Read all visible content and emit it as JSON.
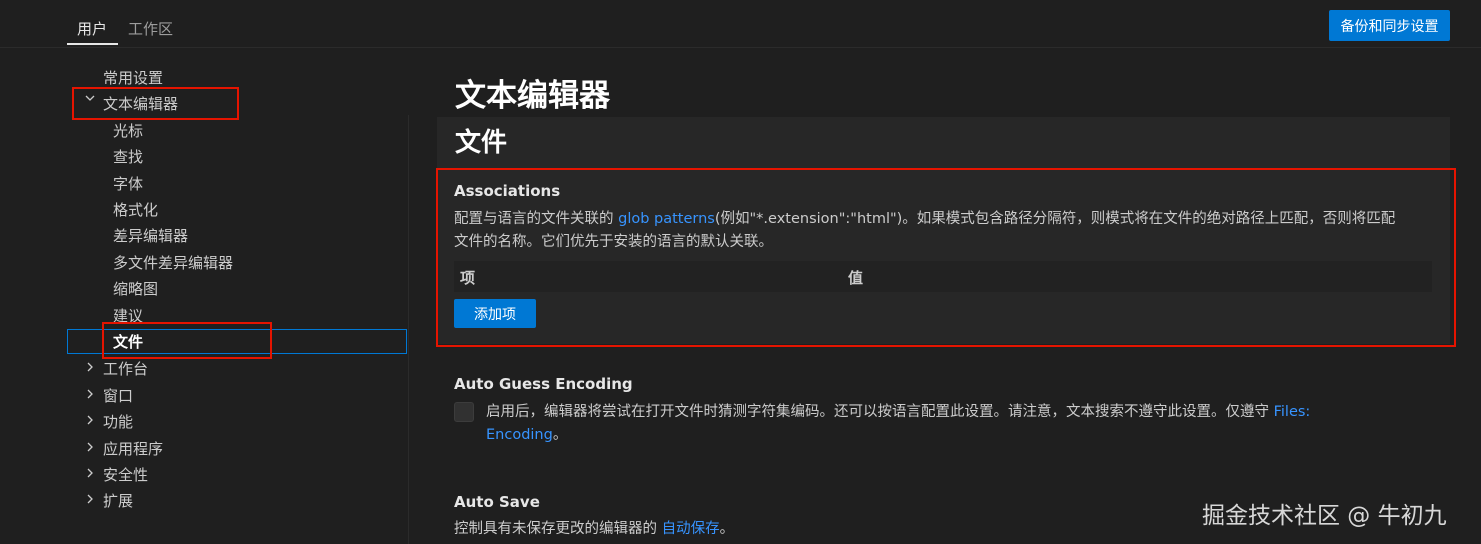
{
  "header": {
    "tabs": [
      {
        "label": "用户",
        "active": true
      },
      {
        "label": "工作区",
        "active": false
      }
    ],
    "sync_button": "备份和同步设置"
  },
  "sidebar": {
    "items": [
      {
        "label": "常用设置",
        "chevron": ""
      },
      {
        "label": "文本编辑器",
        "chevron": "expanded"
      },
      {
        "label": "光标"
      },
      {
        "label": "查找"
      },
      {
        "label": "字体"
      },
      {
        "label": "格式化"
      },
      {
        "label": "差异编辑器"
      },
      {
        "label": "多文件差异编辑器"
      },
      {
        "label": "缩略图"
      },
      {
        "label": "建议"
      },
      {
        "label": "文件",
        "selected": true
      },
      {
        "label": "工作台",
        "chevron": "collapsed"
      },
      {
        "label": "窗口",
        "chevron": "collapsed"
      },
      {
        "label": "功能",
        "chevron": "collapsed"
      },
      {
        "label": "应用程序",
        "chevron": "collapsed"
      },
      {
        "label": "安全性",
        "chevron": "collapsed"
      },
      {
        "label": "扩展",
        "chevron": "collapsed"
      }
    ]
  },
  "main": {
    "page_title": "文本编辑器",
    "section_title": "文件",
    "associations": {
      "title": "Associations",
      "desc_part1": "配置与语言的文件关联的 ",
      "desc_link": "glob patterns",
      "desc_part2": "(例如\"*.extension\":\"html\")。如果模式包含路径分隔符，则模式将在文件的绝对路径上匹配，否则将匹配",
      "desc_line2": "文件的名称。它们优先于安装的语言的默认关联。",
      "col_key": "项",
      "col_value": "值",
      "add_button": "添加项"
    },
    "auto_guess_encoding": {
      "title": "Auto Guess Encoding",
      "desc_part1": "启用后，编辑器将尝试在打开文件时猜测字符集编码。还可以按语言配置此设置。请注意，文本搜索不遵守此设置。仅遵守 ",
      "desc_link1": "Files:",
      "desc_link2": "Encoding",
      "desc_part2": "。",
      "checked": false
    },
    "auto_save": {
      "title": "Auto Save",
      "desc_part1": "控制具有未保存更改的编辑器的 ",
      "desc_link": "自动保存",
      "desc_part2": "。"
    }
  },
  "watermark": "掘金技术社区 @ 牛初九",
  "colors": {
    "accent": "#0078d4",
    "link": "#3794ff",
    "annotation_red": "#e51400",
    "background": "#1f1f1f"
  }
}
